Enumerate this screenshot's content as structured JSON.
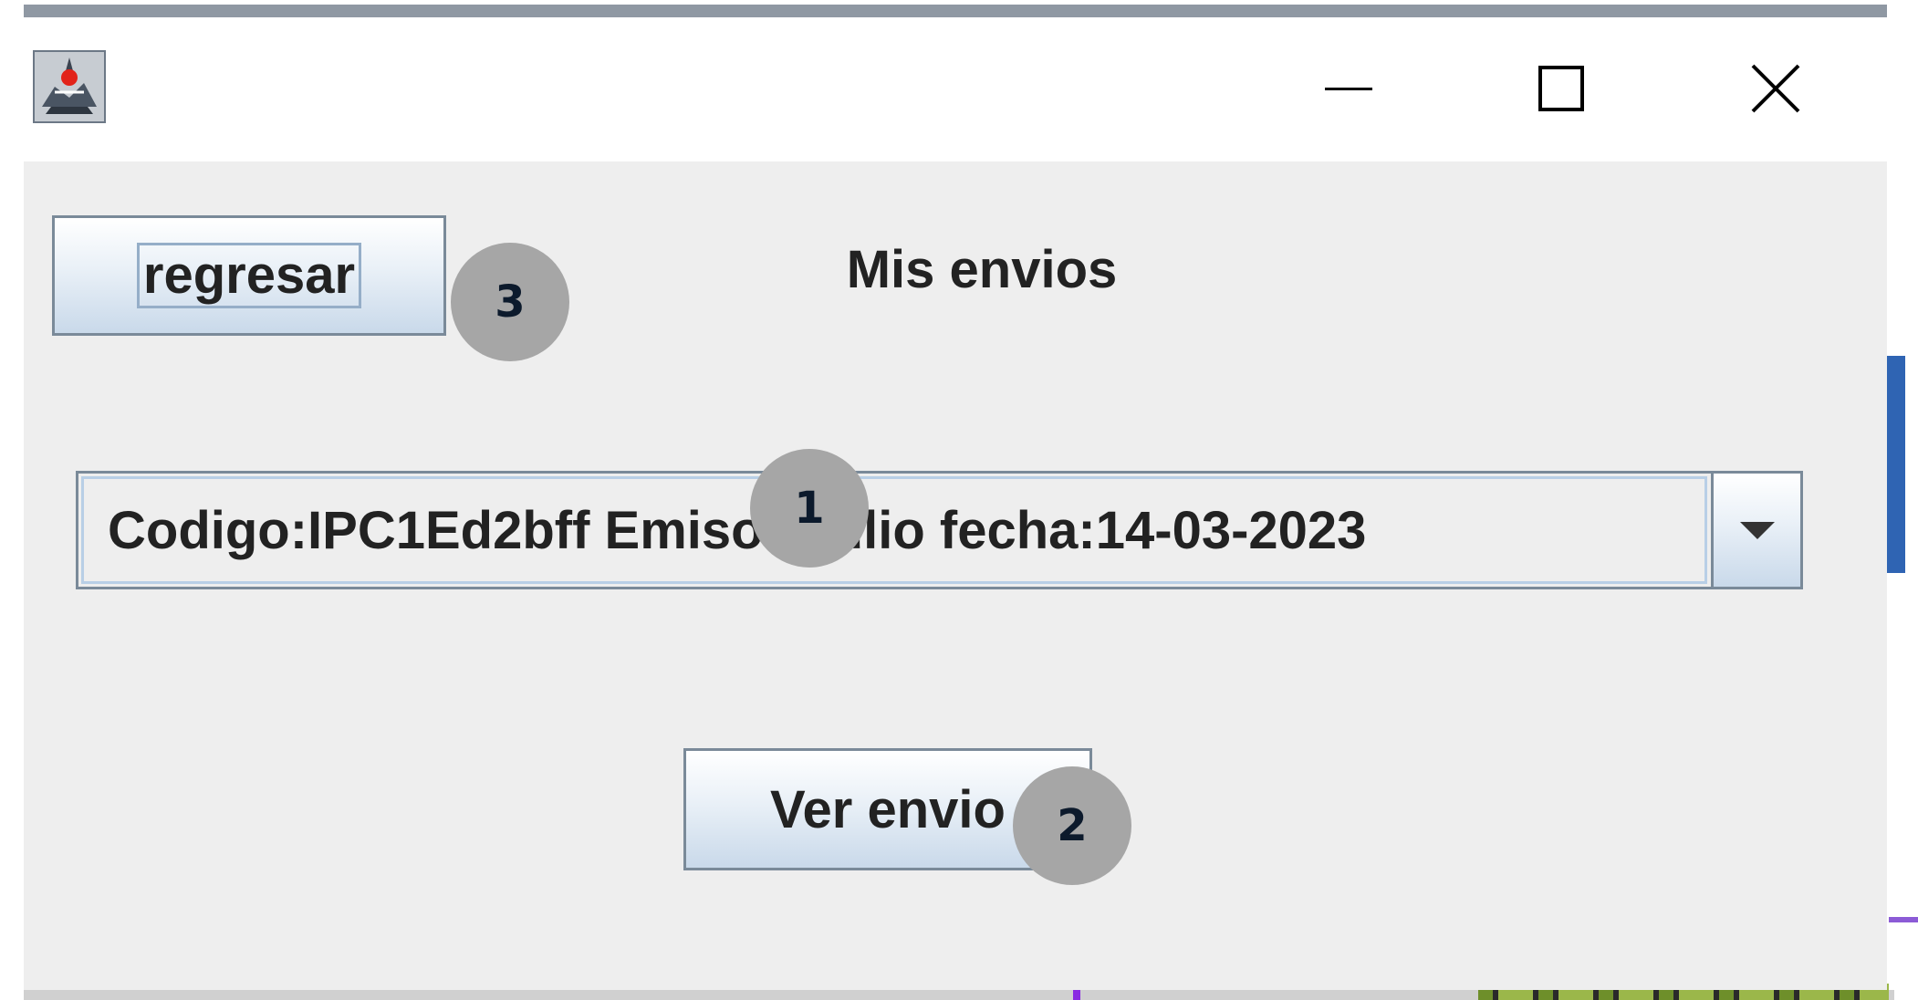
{
  "window": {
    "title": ""
  },
  "header": {
    "back_label": "regresar",
    "title": "Mis envios"
  },
  "shipment_select": {
    "selected": "Codigo:IPC1Ed2bff  Emisor:Julio  fecha:14-03-2023"
  },
  "actions": {
    "view_label": "Ver envio"
  },
  "markers": [
    "1",
    "2",
    "3"
  ],
  "icons": {
    "app": "java-app-icon",
    "minimize": "minimize-icon",
    "maximize": "maximize-icon",
    "close": "close-icon",
    "dropdown": "chevron-down-icon"
  },
  "colors": {
    "window_bg": "#eeeeee",
    "button_border": "#7a8a99",
    "marker": "#a6a6a6"
  }
}
